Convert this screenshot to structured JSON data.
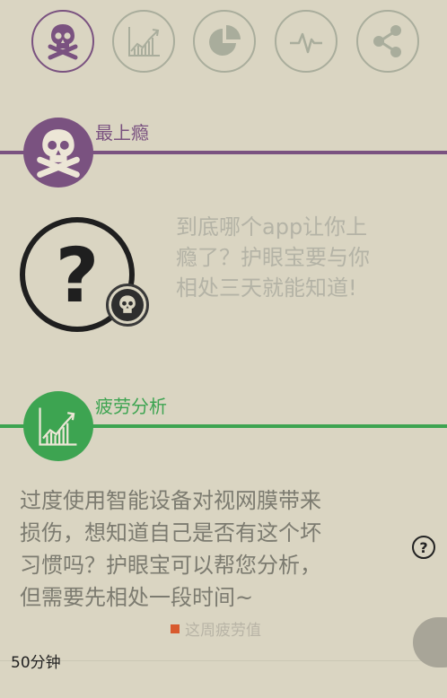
{
  "tabs": [
    {
      "icon": "skull-crossbones-icon",
      "active": true
    },
    {
      "icon": "line-chart-icon",
      "active": false
    },
    {
      "icon": "pie-chart-icon",
      "active": false
    },
    {
      "icon": "pulse-icon",
      "active": false
    },
    {
      "icon": "share-icon",
      "active": false
    }
  ],
  "addiction": {
    "title": "最上瘾",
    "title_color": "#7a5280",
    "line1": "到底哪个app让你上",
    "line2": "瘾了？护眼宝要与你",
    "line3": "相处三天就能知道!"
  },
  "fatigue": {
    "title": "疲劳分析",
    "title_color": "#3da451",
    "line1": "过度使用智能设备对视网膜带来",
    "line2": "损伤，想知道自己是否有这个坏",
    "line3": "习惯吗？护眼宝可以帮您分析，",
    "line4": "但需要先相处一段时间~",
    "help": "?",
    "legend": "这周疲劳值",
    "legend_color": "#d85a2e",
    "value_label": "50分钟"
  },
  "colors": {
    "background": "#dad5c2",
    "purple": "#7a5280",
    "green": "#3da451",
    "inactive": "#a9ad9c"
  }
}
